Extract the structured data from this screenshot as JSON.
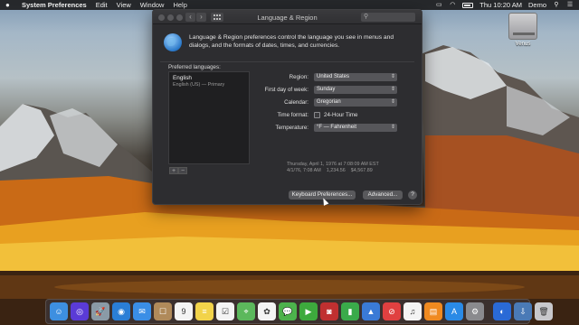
{
  "menubar": {
    "app_name": "System Preferences",
    "menus": [
      "Edit",
      "View",
      "Window",
      "Help"
    ],
    "clock": "Thu 10:20 AM",
    "user": "Demo"
  },
  "window": {
    "title": "Language & Region",
    "description": "Language & Region preferences control the language you see in menus and dialogs, and the formats of dates, times, and currencies.",
    "preferred_label": "Preferred languages:",
    "languages": [
      {
        "name": "English",
        "detail": "English (US) — Primary"
      }
    ],
    "fields": {
      "region": {
        "label": "Region:",
        "value": "United States"
      },
      "first_day": {
        "label": "First day of week:",
        "value": "Sunday"
      },
      "calendar": {
        "label": "Calendar:",
        "value": "Gregorian"
      },
      "time_format": {
        "label": "Time format:",
        "checkbox": "24-Hour Time",
        "checked": false
      },
      "temperature": {
        "label": "Temperature:",
        "value": "°F — Fahrenheit"
      }
    },
    "samples": {
      "line1": "Thursday, April 1, 1976 at 7:08:09 AM EST",
      "line2": "4/1/76, 7:08 AM    1,234.56    $4,567.89"
    },
    "buttons": {
      "keyboard": "Keyboard Preferences...",
      "advanced": "Advanced...",
      "help": "?"
    }
  },
  "desktop": {
    "drive_label": "Venus"
  },
  "dock": {
    "items": [
      {
        "name": "finder-icon",
        "color": "#3d8fe0",
        "glyph": "☺"
      },
      {
        "name": "siri-icon",
        "color": "#5a3bd6",
        "glyph": "◎"
      },
      {
        "name": "launchpad-icon",
        "color": "#8a9aa6",
        "glyph": "🚀"
      },
      {
        "name": "safari-icon",
        "color": "#2a7ed6",
        "glyph": "◉"
      },
      {
        "name": "mail-icon",
        "color": "#3a8ee6",
        "glyph": "✉"
      },
      {
        "name": "contacts-icon",
        "color": "#b08a5a",
        "glyph": "☐"
      },
      {
        "name": "calendar-icon",
        "color": "#f4f4f4",
        "glyph": "9"
      },
      {
        "name": "notes-icon",
        "color": "#f2d34a",
        "glyph": "≡"
      },
      {
        "name": "reminders-icon",
        "color": "#f4f4f4",
        "glyph": "☑"
      },
      {
        "name": "maps-icon",
        "color": "#5cb85c",
        "glyph": "⌖"
      },
      {
        "name": "photos-icon",
        "color": "#f4f4f4",
        "glyph": "✿"
      },
      {
        "name": "messages-icon",
        "color": "#4cb24c",
        "glyph": "💬"
      },
      {
        "name": "facetime-icon",
        "color": "#3daa3d",
        "glyph": "▶"
      },
      {
        "name": "photo-booth-icon",
        "color": "#c03030",
        "glyph": "◙"
      },
      {
        "name": "numbers-icon",
        "color": "#3aaa4a",
        "glyph": "▮"
      },
      {
        "name": "keynote-icon",
        "color": "#3a7ad6",
        "glyph": "▲"
      },
      {
        "name": "news-icon",
        "color": "#e04040",
        "glyph": "⊘"
      },
      {
        "name": "music-icon",
        "color": "#f4f4f4",
        "glyph": "♫"
      },
      {
        "name": "books-icon",
        "color": "#f08a20",
        "glyph": "▤"
      },
      {
        "name": "app-store-icon",
        "color": "#2a8ae6",
        "glyph": "A"
      },
      {
        "name": "system-preferences-icon",
        "color": "#8a8a8e",
        "glyph": "⚙"
      },
      {
        "name": "separator",
        "color": "",
        "glyph": ""
      },
      {
        "name": "airdrop-icon",
        "color": "#2a6ad6",
        "glyph": "◐"
      },
      {
        "name": "downloads-icon",
        "color": "#4a7ab6",
        "glyph": "⇩"
      },
      {
        "name": "trash-icon",
        "color": "#c8c8cc",
        "glyph": "🗑"
      }
    ]
  }
}
